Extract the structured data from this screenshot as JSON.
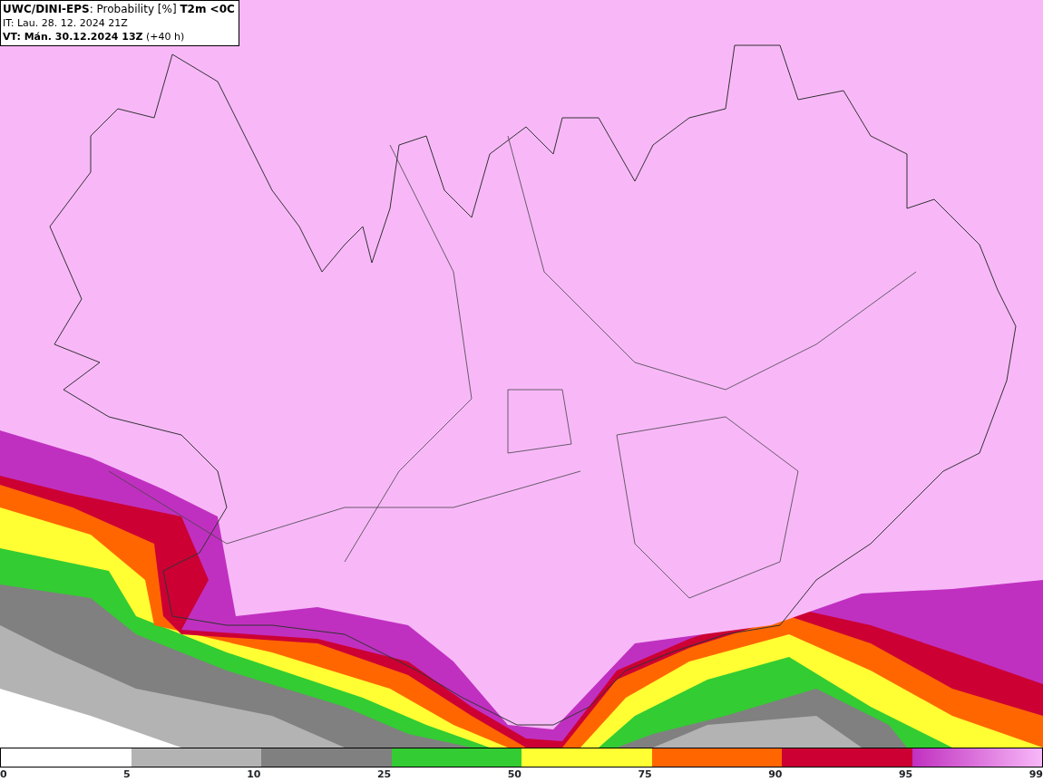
{
  "header": {
    "lines": [
      "**UWC/DINI-EPS**: Probability [%] **T2m <0C**",
      "IT: Lau. 28. 12. 2024 21Z",
      "**VT: Mán. 30.12.2024 13Z** (+40 h)"
    ]
  },
  "legend": {
    "segments": [
      {
        "kind": "blank"
      },
      {
        "kind": "solid",
        "color": "#b3b3b3"
      },
      {
        "kind": "solid",
        "color": "#808080"
      },
      {
        "kind": "solid",
        "color": "#33cc33"
      },
      {
        "kind": "solid",
        "color": "#ffff33"
      },
      {
        "kind": "solid",
        "color": "#ff6600"
      },
      {
        "kind": "solid",
        "color": "#cc0033"
      },
      {
        "kind": "gradient"
      }
    ],
    "labels": [
      "0",
      "5",
      "10",
      "25",
      "50",
      "75",
      "90",
      "95",
      "99"
    ]
  }
}
